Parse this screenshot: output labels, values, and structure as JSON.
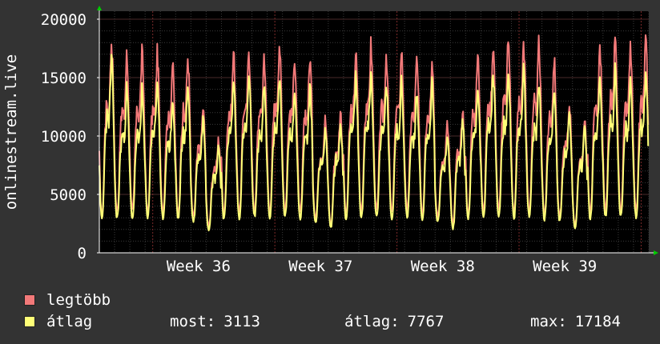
{
  "colors": {
    "background": "#333333",
    "plot_background": "#000000",
    "grid_minor": "#3a3a3a",
    "grid_major": "#5a2a2a",
    "axis": "#ffffff",
    "arrow": "#00cc00",
    "max_series": "#f27979",
    "avg_series": "#ffff77"
  },
  "chart_data": {
    "type": "area",
    "ylabel": "onlinestream.live",
    "ylim": [
      0,
      20000
    ],
    "yticks": [
      "0",
      "5000",
      "10000",
      "15000",
      "20000"
    ],
    "xticks": [
      "Week 36",
      "Week 37",
      "Week 38",
      "Week 39"
    ],
    "grid": true,
    "legend_position": "bottom-left",
    "series": [
      {
        "name": "legtöbb",
        "color": "#f27979",
        "days": [
          {
            "lo": 3300,
            "hi": 18200
          },
          {
            "lo": 3500,
            "hi": 16900
          },
          {
            "lo": 3600,
            "hi": 17200
          },
          {
            "lo": 3400,
            "hi": 17100
          },
          {
            "lo": 3600,
            "hi": 16200
          },
          {
            "lo": 3300,
            "hi": 16800
          },
          {
            "lo": 3100,
            "hi": 12400
          },
          {
            "lo": 2300,
            "hi": 9800
          },
          {
            "lo": 3300,
            "hi": 17200
          },
          {
            "lo": 3400,
            "hi": 17400
          },
          {
            "lo": 3600,
            "hi": 17000
          },
          {
            "lo": 3500,
            "hi": 18000
          },
          {
            "lo": 3700,
            "hi": 16900
          },
          {
            "lo": 3400,
            "hi": 16800
          },
          {
            "lo": 3000,
            "hi": 11500
          },
          {
            "lo": 2400,
            "hi": 12200
          },
          {
            "lo": 3300,
            "hi": 17200
          },
          {
            "lo": 3500,
            "hi": 17800
          },
          {
            "lo": 3600,
            "hi": 17100
          },
          {
            "lo": 3400,
            "hi": 17400
          },
          {
            "lo": 3600,
            "hi": 16500
          },
          {
            "lo": 3300,
            "hi": 17000
          },
          {
            "lo": 3100,
            "hi": 11000
          },
          {
            "lo": 2400,
            "hi": 12300
          },
          {
            "lo": 3300,
            "hi": 17000
          },
          {
            "lo": 3500,
            "hi": 17900
          },
          {
            "lo": 3600,
            "hi": 18400
          },
          {
            "lo": 3400,
            "hi": 18100
          },
          {
            "lo": 3600,
            "hi": 17800
          },
          {
            "lo": 3300,
            "hi": 16600
          },
          {
            "lo": 3100,
            "hi": 12900
          },
          {
            "lo": 2300,
            "hi": 11200
          },
          {
            "lo": 3300,
            "hi": 17700
          },
          {
            "lo": 3500,
            "hi": 18400
          },
          {
            "lo": 3600,
            "hi": 17600
          },
          {
            "lo": 3400,
            "hi": 18300
          }
        ]
      },
      {
        "name": "átlag",
        "color": "#ffff77",
        "days": [
          {
            "lo": 2900,
            "hi": 16500
          },
          {
            "lo": 3000,
            "hi": 14100
          },
          {
            "lo": 3000,
            "hi": 13900
          },
          {
            "lo": 3100,
            "hi": 14800
          },
          {
            "lo": 3000,
            "hi": 13000
          },
          {
            "lo": 2900,
            "hi": 14400
          },
          {
            "lo": 2700,
            "hi": 11600
          },
          {
            "lo": 2000,
            "hi": 9200
          },
          {
            "lo": 2900,
            "hi": 14800
          },
          {
            "lo": 3000,
            "hi": 15100
          },
          {
            "lo": 3100,
            "hi": 14300
          },
          {
            "lo": 3000,
            "hi": 15200
          },
          {
            "lo": 3100,
            "hi": 14200
          },
          {
            "lo": 2900,
            "hi": 14100
          },
          {
            "lo": 2600,
            "hi": 10800
          },
          {
            "lo": 2100,
            "hi": 11200
          },
          {
            "lo": 2900,
            "hi": 15000
          },
          {
            "lo": 3000,
            "hi": 15600
          },
          {
            "lo": 3100,
            "hi": 14500
          },
          {
            "lo": 3000,
            "hi": 14900
          },
          {
            "lo": 3100,
            "hi": 13800
          },
          {
            "lo": 2900,
            "hi": 14600
          },
          {
            "lo": 2700,
            "hi": 10200
          },
          {
            "lo": 2000,
            "hi": 11500
          },
          {
            "lo": 2900,
            "hi": 14500
          },
          {
            "lo": 3000,
            "hi": 15500
          },
          {
            "lo": 3100,
            "hi": 15300
          },
          {
            "lo": 3000,
            "hi": 15500
          },
          {
            "lo": 3100,
            "hi": 14700
          },
          {
            "lo": 2900,
            "hi": 14100
          },
          {
            "lo": 2700,
            "hi": 12000
          },
          {
            "lo": 2000,
            "hi": 10800
          },
          {
            "lo": 2900,
            "hi": 15000
          },
          {
            "lo": 3000,
            "hi": 15800
          },
          {
            "lo": 3100,
            "hi": 14800
          },
          {
            "lo": 3000,
            "hi": 15400
          }
        ]
      }
    ]
  },
  "legend": {
    "max_label": "legtöbb",
    "avg_label": "átlag"
  },
  "stats": {
    "most_label": "most:",
    "most_value": "3113",
    "avg_label": "átlag:",
    "avg_value": "7767",
    "max_label": "max:",
    "max_value": "17184"
  }
}
